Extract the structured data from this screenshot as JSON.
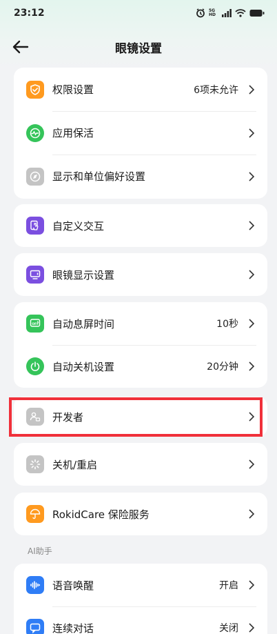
{
  "status_bar": {
    "time": "23:12",
    "network": "5G HD"
  },
  "nav": {
    "title": "眼镜设置"
  },
  "cards": {
    "permissions": {
      "label": "权限设置",
      "value": "6项未允许"
    },
    "keep_alive": {
      "label": "应用保活"
    },
    "display_units": {
      "label": "显示和单位偏好设置"
    },
    "custom_interaction": {
      "label": "自定义交互"
    },
    "glasses_display": {
      "label": "眼镜显示设置"
    },
    "screen_off": {
      "label": "自动息屏时间",
      "value": "10秒"
    },
    "auto_shutdown": {
      "label": "自动关机设置",
      "value": "20分钟"
    },
    "developer": {
      "label": "开发者"
    },
    "power": {
      "label": "关机/重启"
    },
    "insurance": {
      "label": "RokidCare 保险服务"
    },
    "ai_section": {
      "title": "AI助手"
    },
    "voice_wake": {
      "label": "语音唤醒",
      "value": "开启"
    },
    "continuous_chat": {
      "label": "连续对话",
      "value": "关闭"
    }
  },
  "colors": {
    "orange": "#ff9a1f",
    "green": "#35c45a",
    "gray": "#c4c4c4",
    "purple": "#7b4fe0",
    "blue": "#2f7df6",
    "highlight": "#f0303a"
  },
  "icons": {
    "permissions": "shield-check-icon",
    "keep_alive": "heartbeat-icon",
    "display_units": "compass-icon",
    "custom_interaction": "touch-gesture-icon",
    "glasses_display": "monitor-icon",
    "screen_off": "screen-off-icon",
    "auto_shutdown": "power-icon",
    "developer": "developer-badge-icon",
    "power": "loading-spinner-icon",
    "insurance": "umbrella-icon",
    "voice_wake": "waveform-icon",
    "continuous_chat": "chat-icon"
  }
}
